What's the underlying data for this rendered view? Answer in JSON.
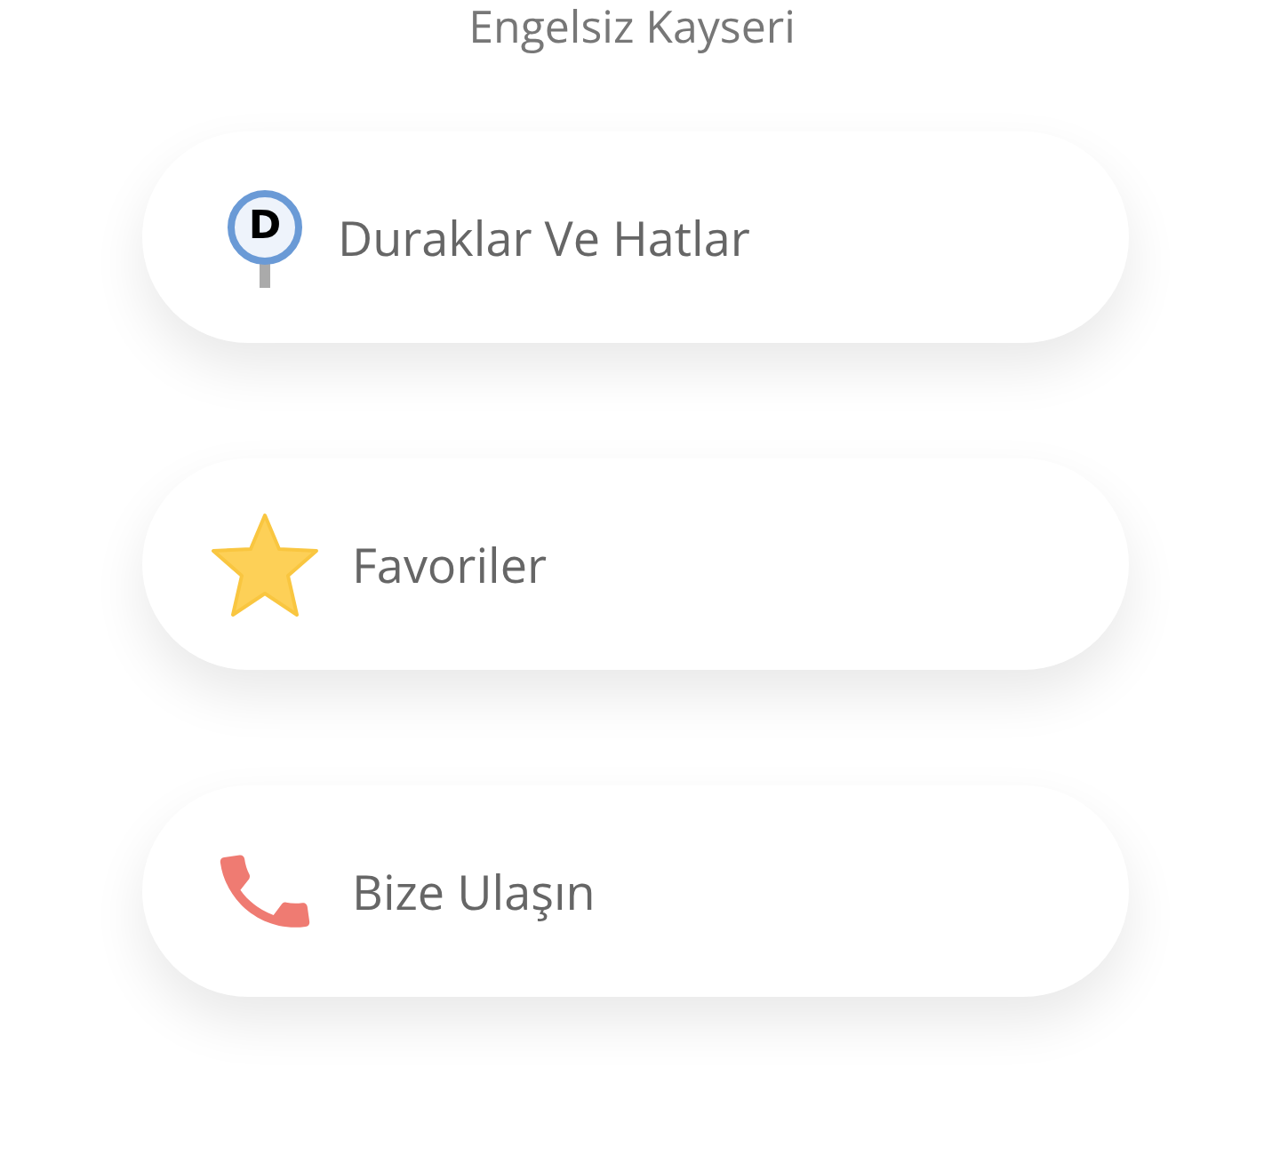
{
  "app_title": "Engelsiz Kayseri",
  "menu": [
    {
      "kind": "stop",
      "icon_letter": "D",
      "label": "Duraklar Ve Hatlar"
    },
    {
      "kind": "star",
      "label": "Favoriler"
    },
    {
      "kind": "phone",
      "label": "Bize Ulaşın"
    }
  ]
}
